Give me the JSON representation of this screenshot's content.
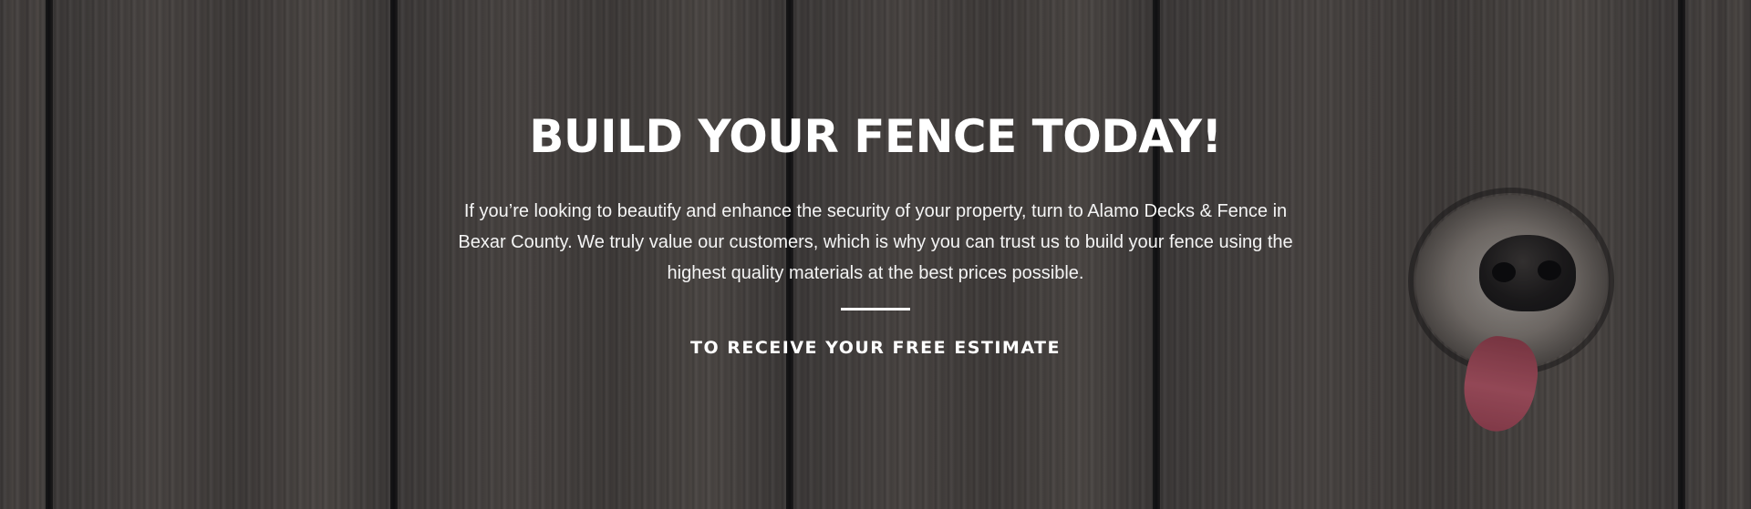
{
  "hero": {
    "title": "BUILD YOUR FENCE TODAY!",
    "description": "If you’re looking to beautify and enhance the security of your property, turn to Alamo Decks & Fence in Bexar County. We truly value our customers, which is why you can trust us to build your fence using the highest quality materials at the best prices possible.",
    "cta_label": "TO RECEIVE YOUR FREE ESTIMATE",
    "background_image": "wood-fence-with-dog-nose",
    "colors": {
      "text": "#ffffff",
      "wood": "#4d4641"
    }
  }
}
